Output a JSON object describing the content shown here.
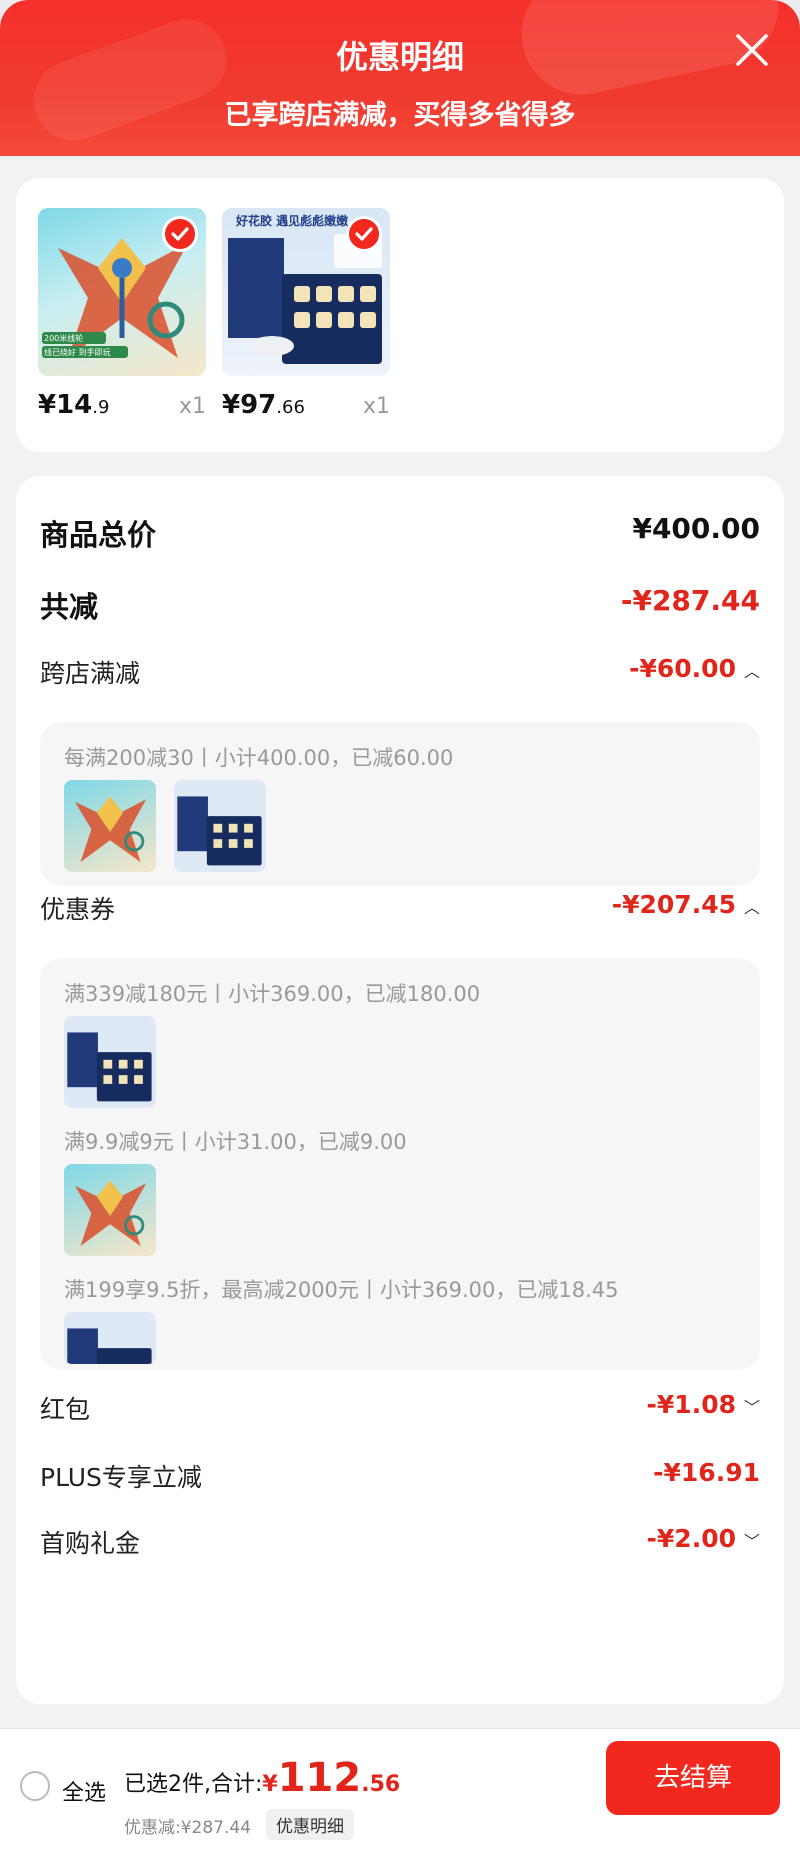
{
  "header": {
    "title": "优惠明细",
    "subtitle": "已享跨店满减，买得多省得多"
  },
  "products": [
    {
      "name": "kite",
      "price_int": "¥14",
      "price_dec": ".9",
      "qty": "x1",
      "badge_line1": "200米线轮",
      "badge_line2": "线已绕好 到手即玩"
    },
    {
      "name": "bird-nest-box",
      "price_int": "¥97",
      "price_dec": ".66",
      "qty": "x1",
      "banner": "好花胶 遇见彪彪嫩嫩"
    }
  ],
  "summary": {
    "total_label": "商品总价",
    "total_value": "¥400.00",
    "reduce_label": "共减",
    "reduce_value": "-¥287.44"
  },
  "cross_store": {
    "label": "跨店满减",
    "value": "-¥60.00",
    "detail": "每满200减30丨小计400.00，已减60.00"
  },
  "coupons": {
    "label": "优惠券",
    "value": "-¥207.45",
    "lines": [
      "满339减180元丨小计369.00，已减180.00",
      "满9.9减9元丨小计31.00，已减9.00",
      "满199享9.5折，最高减2000元丨小计369.00，已减18.45"
    ]
  },
  "red_packet": {
    "label": "红包",
    "value": "-¥1.08"
  },
  "plus": {
    "label": "PLUS专享立减",
    "value": "-¥16.91"
  },
  "first_gift": {
    "label": "首购礼金",
    "value": "-¥2.00"
  },
  "bottom_bar": {
    "select_all": "全选",
    "selected_text": "已选2件,合计:",
    "yuan": "¥",
    "total_int": "112",
    "total_dec": ".56",
    "saved_text": "优惠减:¥287.44",
    "detail_btn": "优惠明细",
    "checkout": "去结算"
  },
  "colors": {
    "accent": "#e1251b",
    "header_red": "#f03a2f"
  },
  "icons": {
    "close": "close-icon",
    "check": "check-icon",
    "chevron_up": "chevron-up-icon",
    "chevron_down": "chevron-down-icon"
  }
}
